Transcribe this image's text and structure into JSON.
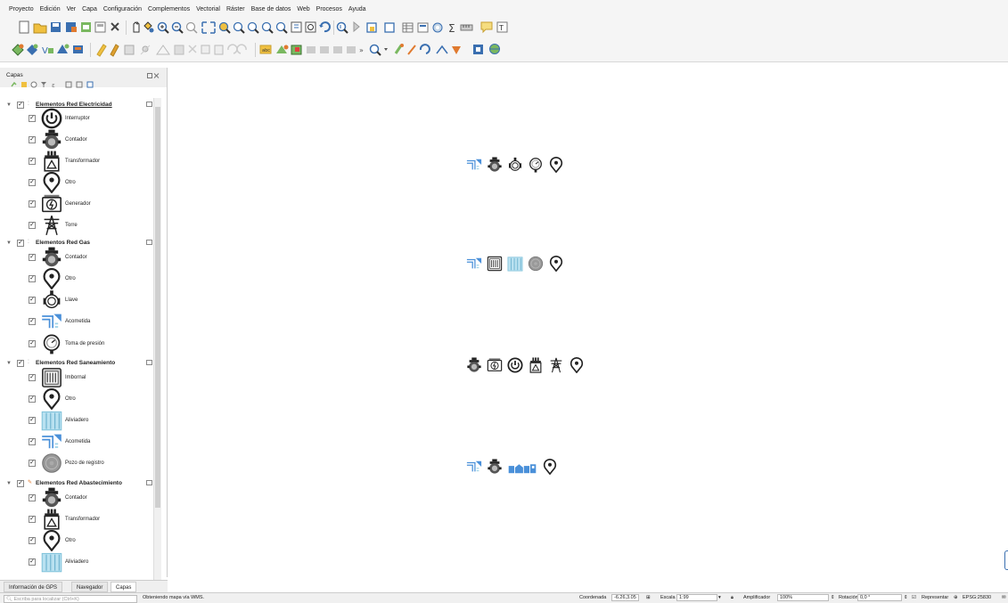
{
  "menu": [
    "Proyecto",
    "Edición",
    "Ver",
    "Capa",
    "Configuración",
    "Complementos",
    "Vectorial",
    "Ráster",
    "Base de datos",
    "Web",
    "Procesos",
    "Ayuda"
  ],
  "panel": {
    "title": "Capas"
  },
  "layers": {
    "electricidad": {
      "label": "Elementos Red Electricidad",
      "items": [
        "Interruptor",
        "Contador",
        "Transformador",
        "Otro",
        "Generador",
        "Torre"
      ]
    },
    "gas": {
      "label": "Elementos Red Gas",
      "items": [
        "Contador",
        "Otro",
        "Llave",
        "Acometida",
        "Toma de presión"
      ]
    },
    "saneamiento": {
      "label": "Elementos Red Saneamiento",
      "items": [
        "Imbornal",
        "Otro",
        "Aliviadero",
        "Acometida",
        "Pozo de registro"
      ]
    },
    "abastecimiento": {
      "label": "Elementos Red Abastecimiento",
      "items": [
        "Contador",
        "Transformador",
        "Otro",
        "Aliviadero"
      ]
    }
  },
  "tabs": [
    "Información de GPS",
    "Navegador",
    "Capas"
  ],
  "status": {
    "locator_placeholder": "Escriba para localizar (Ctrl+K)",
    "message": "Obteniendo mapa vía WMS.",
    "coord_label": "Coordenada",
    "coord_value": "-6.26,3.05",
    "scale_label": "Escala",
    "scale_value": "1:99",
    "magnifier_label": "Amplificador",
    "magnifier_value": "100%",
    "rotation_label": "Rotación",
    "rotation_value": "0,0 °",
    "render_label": "Representar",
    "crs": "EPSG:25830"
  },
  "colors": {
    "accent_blue": "#4a90d9",
    "light_blue": "#9fd3e8",
    "icon_dark": "#222222",
    "grey": "#888888"
  }
}
